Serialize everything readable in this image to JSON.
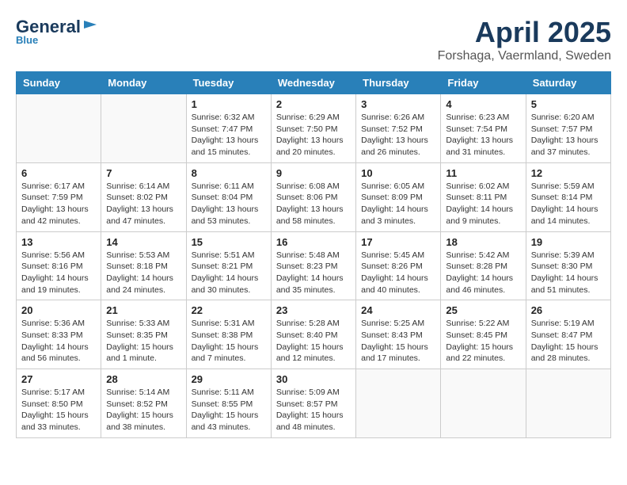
{
  "header": {
    "logo_main": "General",
    "logo_accent": "Blue",
    "title": "April 2025",
    "location": "Forshaga, Vaermland, Sweden"
  },
  "weekdays": [
    "Sunday",
    "Monday",
    "Tuesday",
    "Wednesday",
    "Thursday",
    "Friday",
    "Saturday"
  ],
  "weeks": [
    [
      {
        "day": "",
        "info": ""
      },
      {
        "day": "",
        "info": ""
      },
      {
        "day": "1",
        "info": "Sunrise: 6:32 AM\nSunset: 7:47 PM\nDaylight: 13 hours and 15 minutes."
      },
      {
        "day": "2",
        "info": "Sunrise: 6:29 AM\nSunset: 7:50 PM\nDaylight: 13 hours and 20 minutes."
      },
      {
        "day": "3",
        "info": "Sunrise: 6:26 AM\nSunset: 7:52 PM\nDaylight: 13 hours and 26 minutes."
      },
      {
        "day": "4",
        "info": "Sunrise: 6:23 AM\nSunset: 7:54 PM\nDaylight: 13 hours and 31 minutes."
      },
      {
        "day": "5",
        "info": "Sunrise: 6:20 AM\nSunset: 7:57 PM\nDaylight: 13 hours and 37 minutes."
      }
    ],
    [
      {
        "day": "6",
        "info": "Sunrise: 6:17 AM\nSunset: 7:59 PM\nDaylight: 13 hours and 42 minutes."
      },
      {
        "day": "7",
        "info": "Sunrise: 6:14 AM\nSunset: 8:02 PM\nDaylight: 13 hours and 47 minutes."
      },
      {
        "day": "8",
        "info": "Sunrise: 6:11 AM\nSunset: 8:04 PM\nDaylight: 13 hours and 53 minutes."
      },
      {
        "day": "9",
        "info": "Sunrise: 6:08 AM\nSunset: 8:06 PM\nDaylight: 13 hours and 58 minutes."
      },
      {
        "day": "10",
        "info": "Sunrise: 6:05 AM\nSunset: 8:09 PM\nDaylight: 14 hours and 3 minutes."
      },
      {
        "day": "11",
        "info": "Sunrise: 6:02 AM\nSunset: 8:11 PM\nDaylight: 14 hours and 9 minutes."
      },
      {
        "day": "12",
        "info": "Sunrise: 5:59 AM\nSunset: 8:14 PM\nDaylight: 14 hours and 14 minutes."
      }
    ],
    [
      {
        "day": "13",
        "info": "Sunrise: 5:56 AM\nSunset: 8:16 PM\nDaylight: 14 hours and 19 minutes."
      },
      {
        "day": "14",
        "info": "Sunrise: 5:53 AM\nSunset: 8:18 PM\nDaylight: 14 hours and 24 minutes."
      },
      {
        "day": "15",
        "info": "Sunrise: 5:51 AM\nSunset: 8:21 PM\nDaylight: 14 hours and 30 minutes."
      },
      {
        "day": "16",
        "info": "Sunrise: 5:48 AM\nSunset: 8:23 PM\nDaylight: 14 hours and 35 minutes."
      },
      {
        "day": "17",
        "info": "Sunrise: 5:45 AM\nSunset: 8:26 PM\nDaylight: 14 hours and 40 minutes."
      },
      {
        "day": "18",
        "info": "Sunrise: 5:42 AM\nSunset: 8:28 PM\nDaylight: 14 hours and 46 minutes."
      },
      {
        "day": "19",
        "info": "Sunrise: 5:39 AM\nSunset: 8:30 PM\nDaylight: 14 hours and 51 minutes."
      }
    ],
    [
      {
        "day": "20",
        "info": "Sunrise: 5:36 AM\nSunset: 8:33 PM\nDaylight: 14 hours and 56 minutes."
      },
      {
        "day": "21",
        "info": "Sunrise: 5:33 AM\nSunset: 8:35 PM\nDaylight: 15 hours and 1 minute."
      },
      {
        "day": "22",
        "info": "Sunrise: 5:31 AM\nSunset: 8:38 PM\nDaylight: 15 hours and 7 minutes."
      },
      {
        "day": "23",
        "info": "Sunrise: 5:28 AM\nSunset: 8:40 PM\nDaylight: 15 hours and 12 minutes."
      },
      {
        "day": "24",
        "info": "Sunrise: 5:25 AM\nSunset: 8:43 PM\nDaylight: 15 hours and 17 minutes."
      },
      {
        "day": "25",
        "info": "Sunrise: 5:22 AM\nSunset: 8:45 PM\nDaylight: 15 hours and 22 minutes."
      },
      {
        "day": "26",
        "info": "Sunrise: 5:19 AM\nSunset: 8:47 PM\nDaylight: 15 hours and 28 minutes."
      }
    ],
    [
      {
        "day": "27",
        "info": "Sunrise: 5:17 AM\nSunset: 8:50 PM\nDaylight: 15 hours and 33 minutes."
      },
      {
        "day": "28",
        "info": "Sunrise: 5:14 AM\nSunset: 8:52 PM\nDaylight: 15 hours and 38 minutes."
      },
      {
        "day": "29",
        "info": "Sunrise: 5:11 AM\nSunset: 8:55 PM\nDaylight: 15 hours and 43 minutes."
      },
      {
        "day": "30",
        "info": "Sunrise: 5:09 AM\nSunset: 8:57 PM\nDaylight: 15 hours and 48 minutes."
      },
      {
        "day": "",
        "info": ""
      },
      {
        "day": "",
        "info": ""
      },
      {
        "day": "",
        "info": ""
      }
    ]
  ]
}
